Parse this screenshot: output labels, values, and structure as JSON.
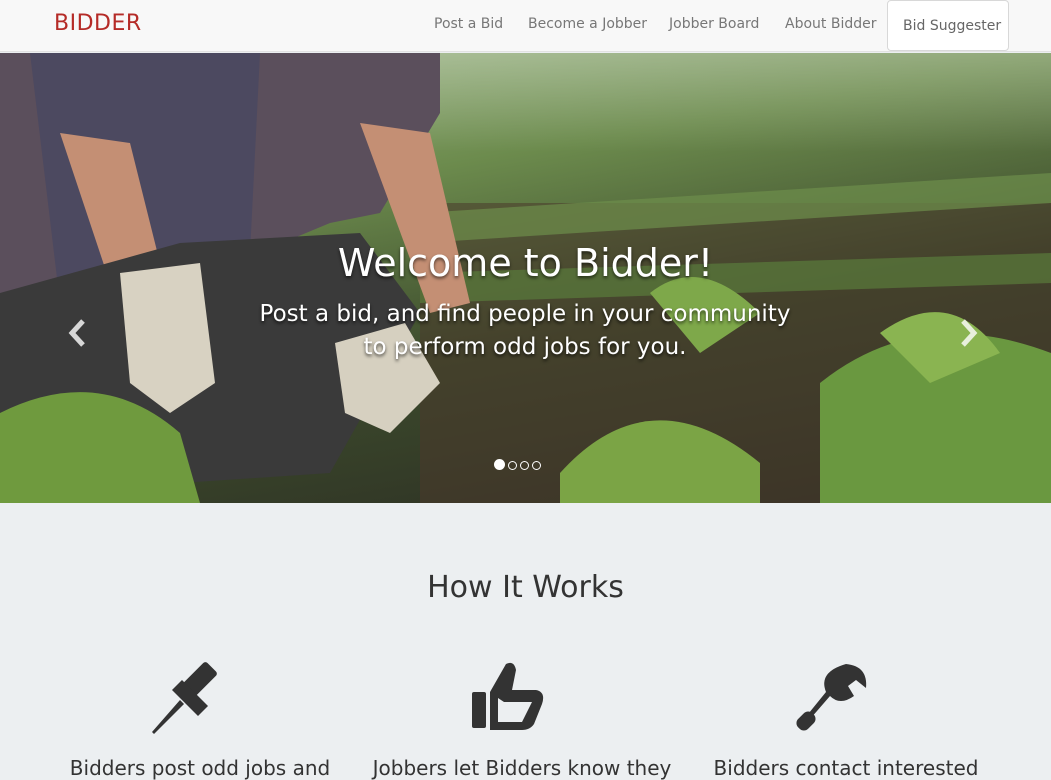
{
  "nav": {
    "brand": "BIDDER",
    "items": [
      {
        "label": "Post a Bid"
      },
      {
        "label": "Become a Jobber"
      },
      {
        "label": "Jobber Board"
      },
      {
        "label": "About Bidder"
      },
      {
        "label": "Bid Suggester"
      }
    ]
  },
  "hero": {
    "title": "Welcome to Bidder!",
    "subtitle": "Post a bid, and find people in your community to perform odd jobs for you.",
    "prev_icon": "chevron-left-icon",
    "next_icon": "chevron-right-icon",
    "slide_count": 4,
    "active_slide": 1
  },
  "how": {
    "title": "How It Works",
    "features": [
      {
        "icon": "pushpin-icon",
        "text": "Bidders post odd jobs and"
      },
      {
        "icon": "thumbs-up-icon",
        "text": "Jobbers let Bidders know they"
      },
      {
        "icon": "wrench-icon",
        "text": "Bidders contact interested"
      }
    ]
  },
  "colors": {
    "brand": "#b52b27",
    "page_bg": "#eceff1",
    "nav_bg": "#f8f8f8"
  }
}
